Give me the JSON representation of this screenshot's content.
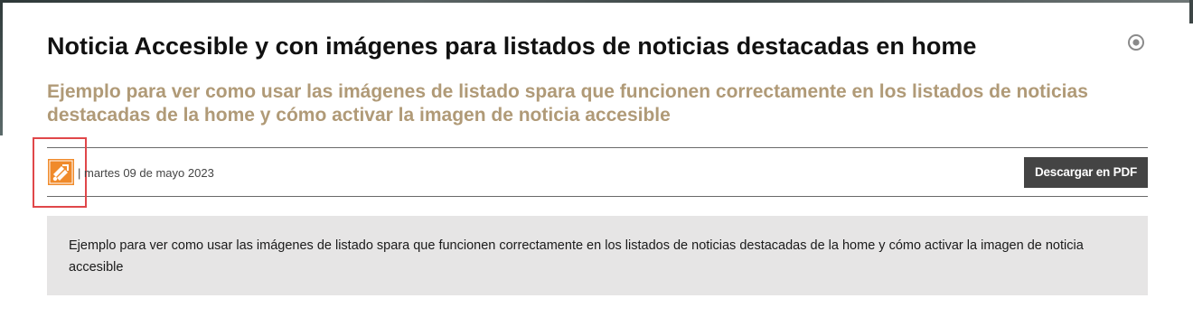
{
  "article": {
    "title": "Noticia Accesible y con imágenes para listados de noticias destacadas en home",
    "subtitle": "Ejemplo para ver como usar las imágenes de listado spara que funcionen correctamente en los listados de noticias destacadas de la home y cómo activar la imagen de noticia accesible",
    "date": "| martes 09 de mayo 2023",
    "summary": "Ejemplo para ver como usar las imágenes de listado spara que funcionen correctamente en los listados de noticias destacadas de la home y cómo activar la imagen de noticia accesible"
  },
  "actions": {
    "pdf_label": "Descargar en PDF"
  },
  "icons": {
    "options": "radio-target-icon",
    "accessible": "accessible-news-icon"
  },
  "colors": {
    "subtitle": "#b09a77",
    "button_bg": "#444444",
    "summary_bg": "#e6e5e5",
    "highlight": "#e0474a",
    "accessible_icon": "#f08a2a"
  }
}
